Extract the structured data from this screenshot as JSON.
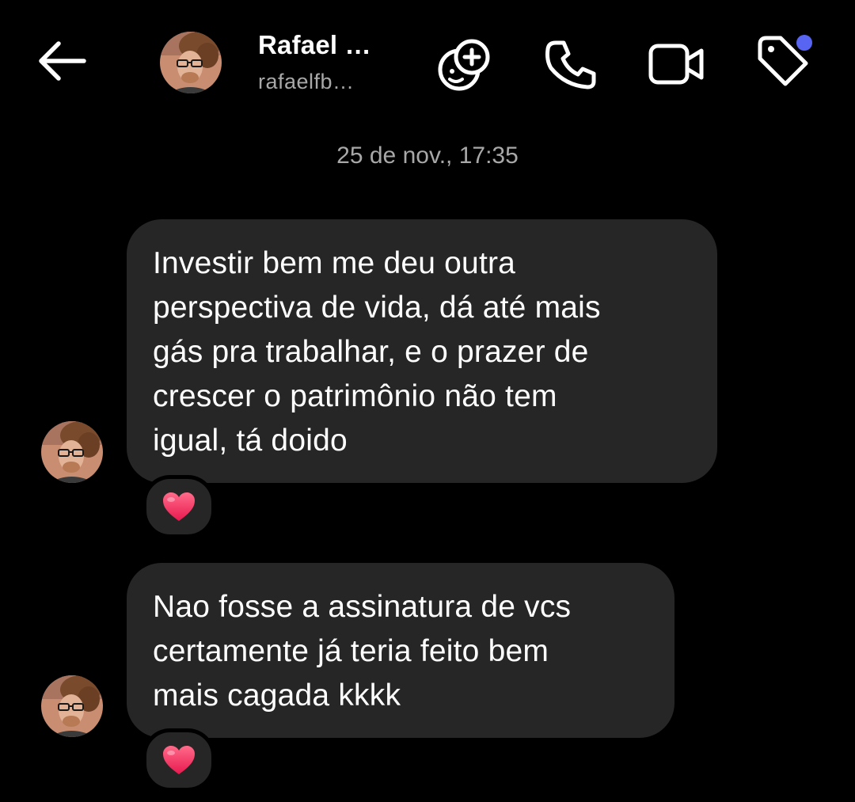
{
  "header": {
    "name": "Rafael …",
    "username": "rafaelfb…",
    "accent_dot_color": "#5865f2"
  },
  "icons": {
    "back": "arrow-left-icon",
    "stickers": "avatar-stickers-icon",
    "call": "phone-icon",
    "video": "video-camera-icon",
    "tag": "tag-icon"
  },
  "conversation": {
    "timestamp": "25 de nov., 17:35",
    "messages": [
      {
        "lines": [
          "Investir bem me deu outra",
          "perspectiva de vida, dá até mais",
          "gás pra trabalhar, e o prazer de",
          "crescer o patrimônio não tem",
          "igual, tá doido"
        ],
        "reaction": "❤️"
      },
      {
        "lines": [
          "Nao fosse a assinatura de vcs",
          "certamente já teria feito bem",
          "mais cagada kkkk"
        ],
        "reaction": "❤️"
      }
    ]
  },
  "colors": {
    "background": "#000000",
    "bubble": "#262626",
    "secondary_text": "#a8a8a8",
    "heart": "#ff3b6b"
  }
}
